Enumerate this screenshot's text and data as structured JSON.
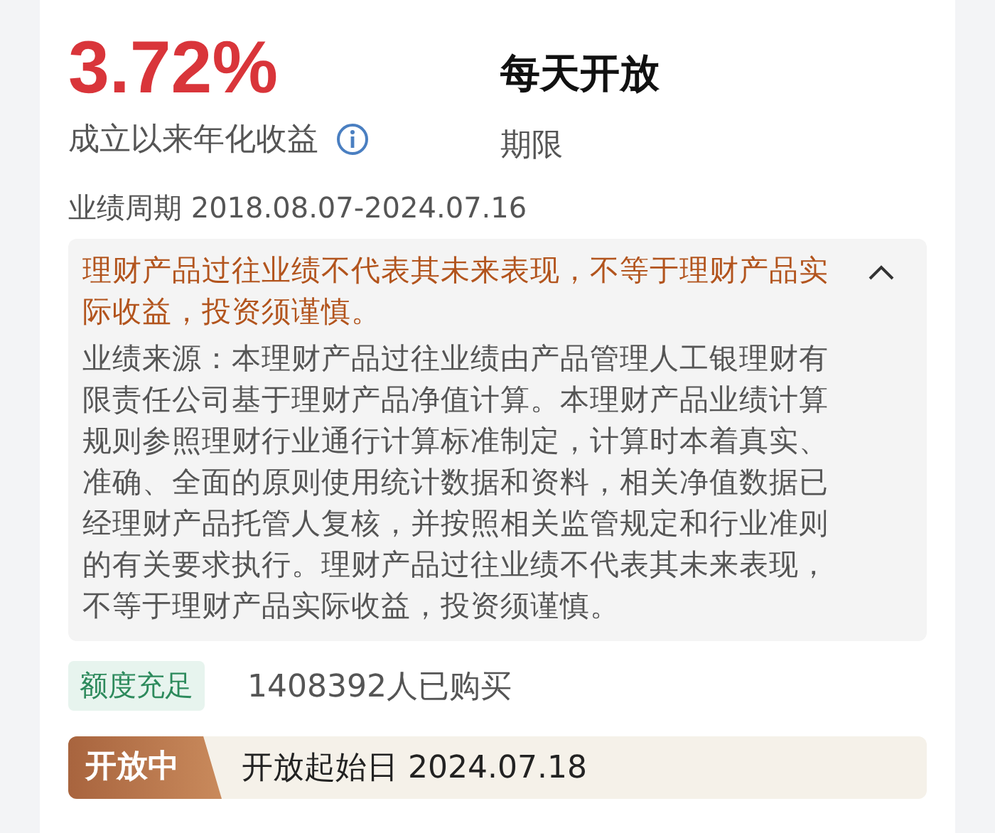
{
  "rate": {
    "value": "3.72%",
    "label": "成立以来年化收益"
  },
  "term": {
    "value": "每天开放",
    "label": "期限"
  },
  "period": "业绩周期 2018.08.07-2024.07.16",
  "notice": {
    "warning": "理财产品过往业绩不代表其未来表现，不等于理财产品实际收益，投资须谨慎。",
    "expanded": true,
    "body": "业绩来源：本理财产品过往业绩由产品管理人工银理财有限责任公司基于理财产品净值计算。本理财产品业绩计算规则参照理财行业通行计算标准制定，计算时本着真实、准确、全面的原则使用统计数据和资料，相关净值数据已经理财产品托管人复核，并按照相关监管规定和行业准则的有关要求执行。理财产品过往业绩不代表其未来表现，不等于理财产品实际收益，投资须谨慎。"
  },
  "quota_tag": "额度充足",
  "buyers": "1408392人已购买",
  "open_status": {
    "tag": "开放中",
    "text": "开放起始日 2024.07.18"
  }
}
